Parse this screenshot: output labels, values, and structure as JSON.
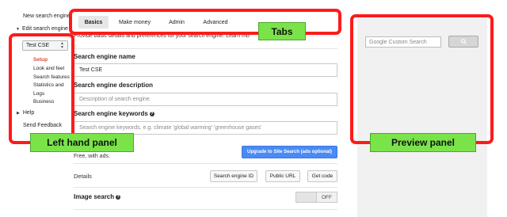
{
  "left_panel": {
    "new_engine": "New search engine",
    "edit_engine": "Edit search engine",
    "engine_selected": "Test CSE",
    "sub_items": [
      "Setup",
      "Look and feel",
      "Search features",
      "Statistics and",
      "Logs",
      "Business"
    ],
    "help": "Help",
    "send_feedback": "Send Feedback"
  },
  "tabs": [
    "Basics",
    "Make money",
    "Admin",
    "Advanced"
  ],
  "intro": "Provide basic details and preferences for your search engine. Learn mo",
  "form": {
    "name_label": "Search engine name",
    "name_value": "Test CSE",
    "desc_label": "Search engine description",
    "desc_placeholder": "Description of search engine.",
    "keywords_label": "Search engine keywords",
    "keywords_placeholder": "Search engine keywords, e.g. climate 'global warming' 'greenhouse gases'",
    "upgrade_button": "Upgrade to Site Search (ads optional)",
    "edition_text": "Free, with ads.",
    "details_label": "Details",
    "details_buttons": [
      "Search engine ID",
      "Public URL",
      "Get code"
    ],
    "image_search_label": "Image search",
    "image_search_state": "OFF",
    "help_glyph": "?"
  },
  "preview": {
    "search_placeholder": "Google Custom Search"
  },
  "annotations": {
    "tabs": "Tabs",
    "left_panel": "Left hand panel",
    "preview_panel": "Preview panel"
  },
  "colors": {
    "annotation_border": "#ff1a1a",
    "annotation_label_bg": "#7be34a",
    "active_nav": "#dd4b39",
    "upgrade_button": "#4a8af4"
  },
  "icons": {
    "expand_open": "triangle-down-icon",
    "expand_closed": "triangle-right-icon",
    "select_arrows": "updown-arrows-icon",
    "help": "question-circle-icon",
    "search": "magnifier-icon"
  }
}
